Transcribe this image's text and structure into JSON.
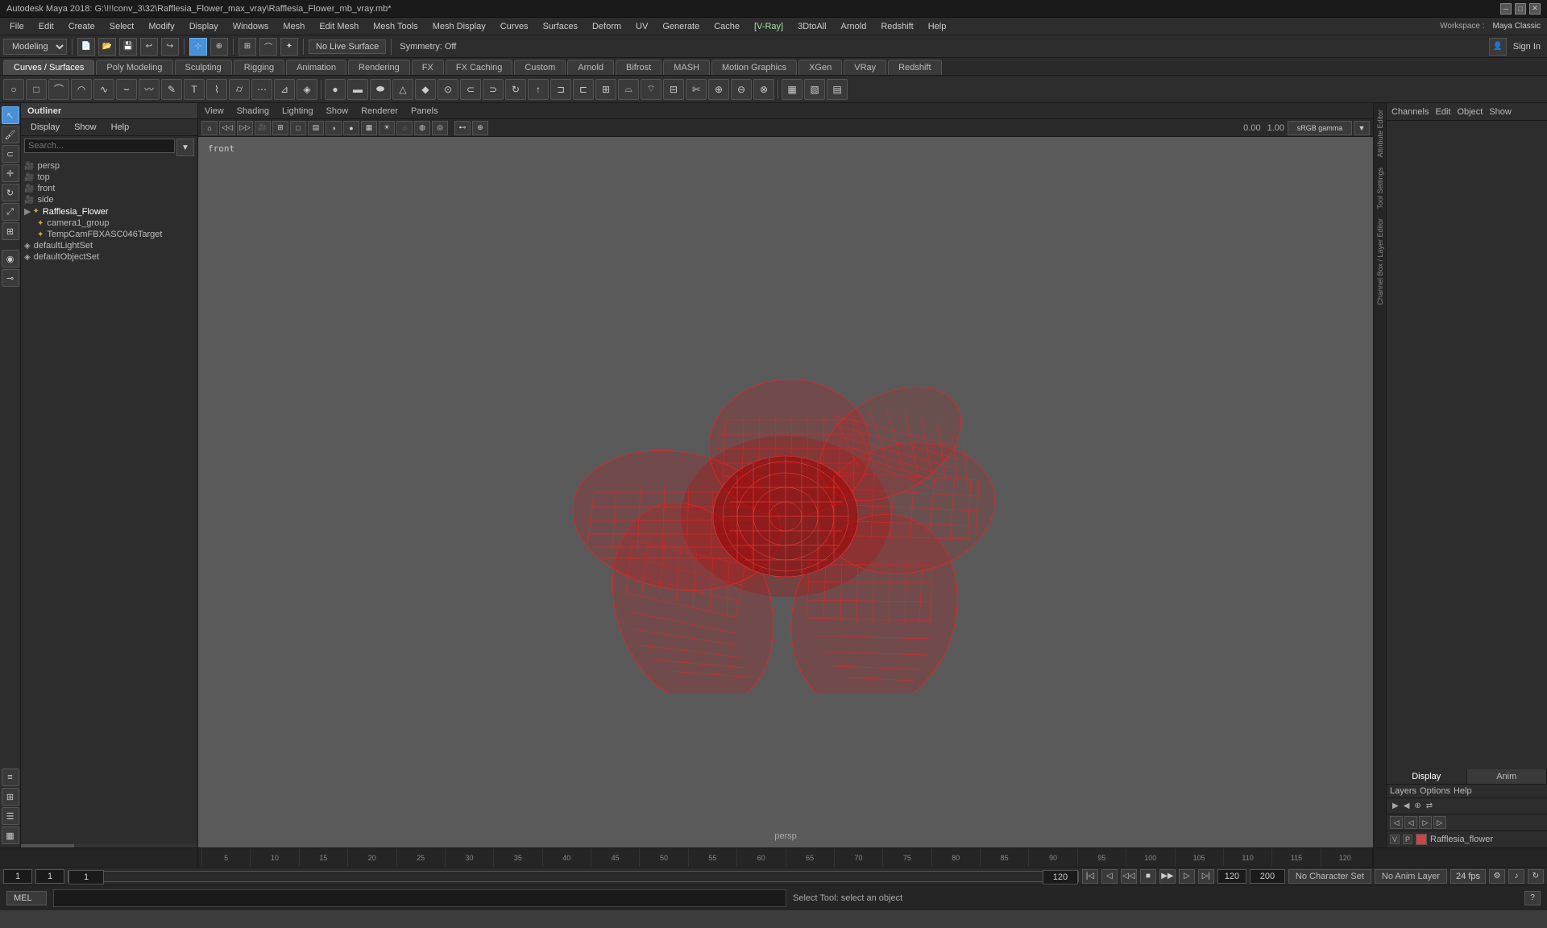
{
  "titlebar": {
    "title": "Autodesk Maya 2018: G:\\!!!conv_3\\32\\Rafflesia_Flower_max_vray\\Rafflesia_Flower_mb_vray.mb*"
  },
  "menu": {
    "items": [
      "File",
      "Edit",
      "Create",
      "Select",
      "Modify",
      "Display",
      "Windows",
      "Mesh",
      "Edit Mesh",
      "Mesh Tools",
      "Mesh Display",
      "Curves",
      "Surfaces",
      "Deform",
      "UV",
      "Generate",
      "Cache",
      "[V-Ray]",
      "3DtoAll",
      "Arnold",
      "Redshift",
      "Help"
    ]
  },
  "toolbar": {
    "workspace_label": "Workspace :",
    "workspace_value": "Maya Classic",
    "mode_label": "Modeling",
    "no_live_surface": "No Live Surface",
    "symmetry": "Symmetry: Off",
    "sign_in": "Sign In"
  },
  "tabs": {
    "items": [
      "Curves / Surfaces",
      "Poly Modeling",
      "Sculpting",
      "Rigging",
      "Animation",
      "Rendering",
      "FX",
      "FX Caching",
      "Custom",
      "Arnold",
      "Bifrost",
      "MASH",
      "Motion Graphics",
      "XGen",
      "VRay",
      "Redshift"
    ]
  },
  "outliner": {
    "title": "Outliner",
    "menu_items": [
      "Display",
      "Show",
      "Help"
    ],
    "search_placeholder": "Search...",
    "items": [
      {
        "name": "persp",
        "type": "camera",
        "indent": 0
      },
      {
        "name": "top",
        "type": "camera",
        "indent": 0
      },
      {
        "name": "front",
        "type": "camera",
        "indent": 0
      },
      {
        "name": "side",
        "type": "camera",
        "indent": 0
      },
      {
        "name": "Rafflesia_Flower",
        "type": "group",
        "indent": 0
      },
      {
        "name": "camera1_group",
        "type": "group",
        "indent": 1
      },
      {
        "name": "TempCamFBXASC046Target",
        "type": "group",
        "indent": 1
      },
      {
        "name": "defaultLightSet",
        "type": "set",
        "indent": 0
      },
      {
        "name": "defaultObjectSet",
        "type": "set",
        "indent": 0
      }
    ]
  },
  "viewport": {
    "menu": [
      "View",
      "Shading",
      "Lighting",
      "Show",
      "Renderer",
      "Panels"
    ],
    "label": "front",
    "persp_label": "persp",
    "gamma_label": "sRGB gamma",
    "value1": "0.00",
    "value2": "1.00"
  },
  "channel_box": {
    "header_items": [
      "Channels",
      "Edit",
      "Object",
      "Show"
    ],
    "display_tab": "Display",
    "anim_tab": "Anim",
    "layers_menu": [
      "Layers",
      "Options",
      "Help"
    ],
    "layer_items": [
      {
        "v": "V",
        "p": "P",
        "color": "#cc4444",
        "name": "Rafflesia_flower"
      }
    ]
  },
  "playback": {
    "current_frame": "1",
    "start_frame": "1",
    "range_start": "1",
    "range_end": "120",
    "end_frame": "120",
    "max_frame": "200",
    "fps": "24 fps",
    "no_character_set": "No Character Set",
    "no_anim_layer": "No Anim Layer"
  },
  "status": {
    "mel_label": "MEL",
    "command_placeholder": "",
    "status_text": "Select Tool: select an object"
  },
  "timeline_ticks": [
    "5",
    "10",
    "15",
    "20",
    "25",
    "30",
    "35",
    "40",
    "45",
    "50",
    "55",
    "60",
    "65",
    "70",
    "75",
    "80",
    "85",
    "90",
    "95",
    "100",
    "105",
    "110",
    "115",
    "120"
  ]
}
